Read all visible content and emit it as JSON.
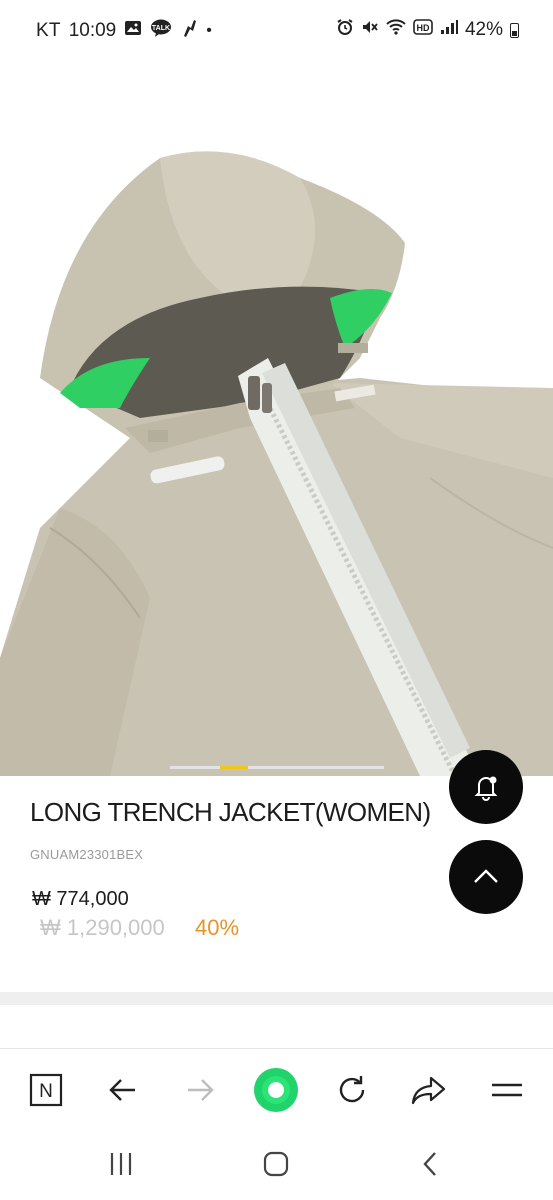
{
  "status_bar": {
    "carrier": "KT",
    "time": "10:09",
    "notification_icons": [
      "gallery-icon",
      "kakaotalk-icon",
      "app-icon"
    ],
    "kakao_label": "TALK",
    "dot": "•",
    "right_icons": [
      "alarm-icon",
      "mute-icon",
      "wifi-icon",
      "hd-voice-icon",
      "signal-icon"
    ],
    "hd_label": "HD",
    "battery": "42%"
  },
  "product": {
    "name": "LONG TRENCH JACKET(WOMEN)",
    "code": "GNUAM23301BEX",
    "sale_price": "₩ 774,000",
    "original_price": "₩ 1,290,000",
    "discount": "40%",
    "image_description_icon": "jacket-photo",
    "slide_progress": 0.27,
    "colors": {
      "jacket": "#c9c3b3",
      "lining": "#2fcf64",
      "zipper": "#eceeea",
      "discount": "#e6952b",
      "indicator": "#f2c419"
    }
  },
  "fabs": {
    "notify_icon": "bell-icon",
    "top_icon": "chevron-up-icon"
  },
  "browser_toolbar": {
    "items": [
      "naver-home-icon",
      "back-arrow-icon",
      "forward-arrow-icon",
      "green-dot-icon",
      "refresh-icon",
      "share-icon",
      "menu-icon"
    ],
    "naver_label": "N",
    "accent": "#21d36b"
  },
  "system_nav": {
    "items": [
      "recent-apps-icon",
      "home-icon",
      "back-icon"
    ]
  }
}
